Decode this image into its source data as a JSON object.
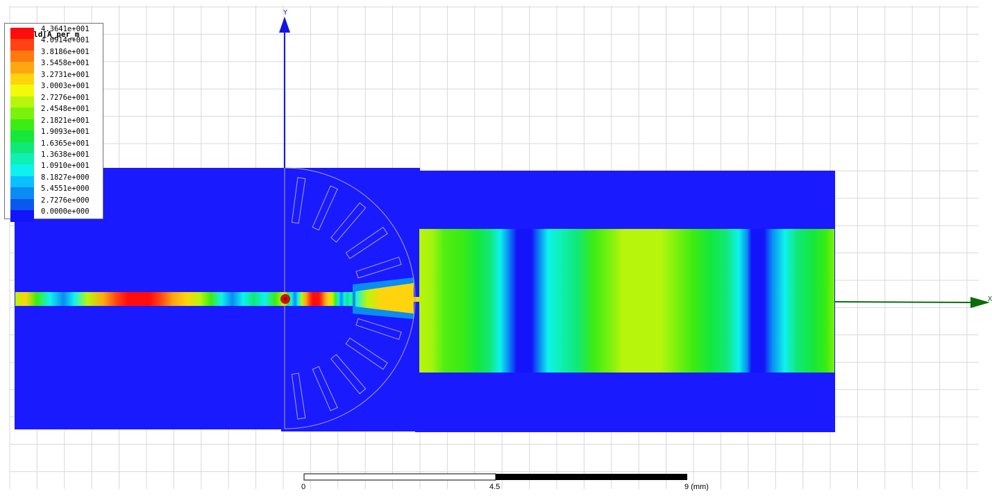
{
  "legend": {
    "title": "H Field[A_per_m",
    "entries": [
      {
        "value": "4.3641e+001",
        "color": "#ff0c0c"
      },
      {
        "value": "4.0914e+001",
        "color": "#ff4212"
      },
      {
        "value": "3.8186e+001",
        "color": "#ff7a0e"
      },
      {
        "value": "3.5458e+001",
        "color": "#ffa612"
      },
      {
        "value": "3.2731e+001",
        "color": "#ffd40c"
      },
      {
        "value": "3.0003e+001",
        "color": "#f2fa0a"
      },
      {
        "value": "2.7276e+001",
        "color": "#b8f50d"
      },
      {
        "value": "2.4548e+001",
        "color": "#7af20d"
      },
      {
        "value": "2.1821e+001",
        "color": "#3cec12"
      },
      {
        "value": "1.9093e+001",
        "color": "#14e83a"
      },
      {
        "value": "1.6365e+001",
        "color": "#10e878"
      },
      {
        "value": "1.3638e+001",
        "color": "#0ef0b4"
      },
      {
        "value": "1.0910e+001",
        "color": "#0ef2ee"
      },
      {
        "value": "8.1827e+000",
        "color": "#0ac0ff"
      },
      {
        "value": "5.4551e+000",
        "color": "#0a8cf2"
      },
      {
        "value": "2.7276e+000",
        "color": "#0a58ee"
      },
      {
        "value": "0.0000e+000",
        "color": "#1414fa"
      }
    ]
  },
  "axes": {
    "y_label": "Y",
    "x_label": "X",
    "y_color": "#1414e6",
    "x_color": "#0a6e0a"
  },
  "scale_bar": {
    "tick_labels": [
      "0",
      "4.5",
      "9 (mm)"
    ]
  },
  "colors": {
    "substrate": "#1a1aff",
    "grid": "#d8d8d8",
    "port_marker": "#cc1010"
  }
}
